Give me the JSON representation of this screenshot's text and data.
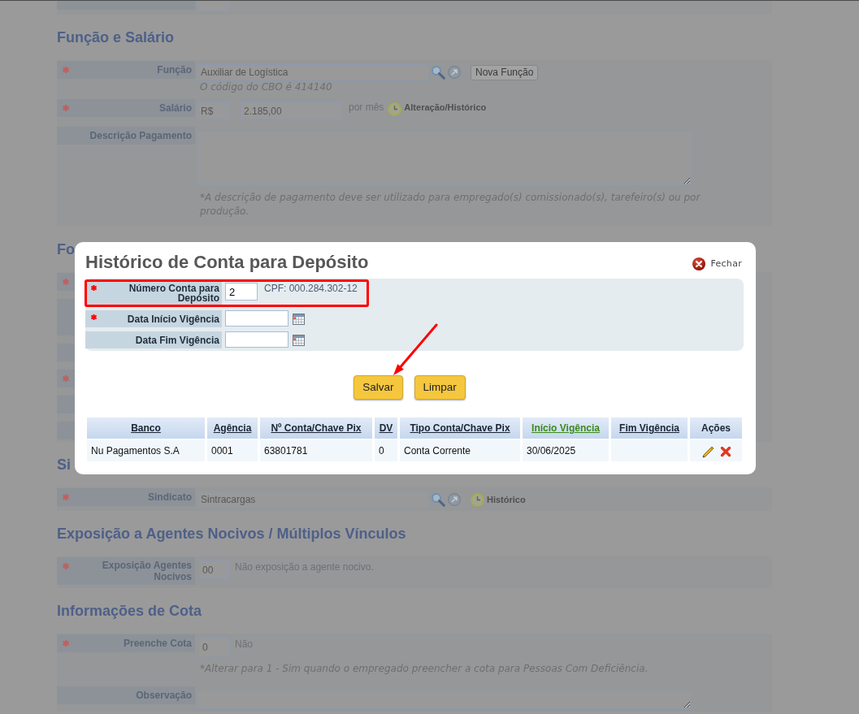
{
  "background_form": {
    "sections": [
      {
        "rows": [
          {
            "kind": "cut_off",
            "required": false
          }
        ]
      },
      {
        "heading": "Função e Salário",
        "rows": [
          {
            "kind": "lookup",
            "label": "Função",
            "required": true,
            "value": "Auxiliar de Logística",
            "button": "Nova Função",
            "hint": "O código do CBO é 414140"
          },
          {
            "kind": "money",
            "label": "Salário",
            "required": true,
            "currency": "R$",
            "value": "2.185,00",
            "suffix": "por mês",
            "history": "Alteração/Histórico"
          },
          {
            "kind": "textarea",
            "label": "Descrição Pagamento",
            "required": false,
            "hint": "*A descrição de pagamento deve ser utilizado para empregado(s) comissionado(s), tarefeiro(s) ou por produção."
          }
        ]
      },
      {
        "heading": "Fo",
        "rows": [
          {
            "kind": "covered",
            "required": true
          },
          {
            "kind": "covered_tall",
            "required": false
          },
          {
            "kind": "covered",
            "required": false
          },
          {
            "kind": "covered",
            "required": true
          },
          {
            "kind": "covered",
            "required": false
          },
          {
            "kind": "covered",
            "required": false
          }
        ]
      },
      {
        "heading": "Si",
        "rows": [
          {
            "kind": "lookup",
            "label": "Sindicato",
            "required": true,
            "value": "Sintracargas",
            "history": "Histórico"
          }
        ]
      },
      {
        "heading": "Exposição a Agentes Nocivos / Múltiplos Vínculos",
        "rows": [
          {
            "kind": "code",
            "label": "Exposição Agentes Nocivos",
            "required": true,
            "value": "00",
            "description": "Não exposição a agente nocivo."
          }
        ]
      },
      {
        "heading": "Informações de Cota",
        "rows": [
          {
            "kind": "code",
            "label": "Preenche Cota",
            "required": true,
            "value": "0",
            "description": "Não",
            "hint": "*Alterar para 1 - Sim quando o empregado preencher a cota para Pessoas Com Deficiência."
          },
          {
            "kind": "textarea",
            "label": "Observação",
            "required": false
          }
        ]
      }
    ]
  },
  "modal": {
    "title": "Histórico de Conta para Depósito",
    "close": "Fechar",
    "fields": [
      {
        "kind": "text",
        "label": "Número Conta para Depósito",
        "required": true,
        "value": "2",
        "note": "CPF: 000.284.302-12",
        "highlighted": true
      },
      {
        "kind": "date",
        "label": "Data Início Vigência",
        "required": true,
        "highlighted": false
      },
      {
        "kind": "date",
        "label": "Data Fim Vigência",
        "required": false,
        "highlighted": false
      }
    ],
    "buttons": [
      {
        "label": "Salvar",
        "pointed": true
      },
      {
        "label": "Limpar",
        "pointed": false
      }
    ],
    "table": {
      "columns": [
        {
          "kind": "sort",
          "label": "Banco",
          "sorted": false
        },
        {
          "kind": "sort",
          "label": "Agência",
          "sorted": false
        },
        {
          "kind": "sort",
          "label": "Nº Conta/Chave Pix",
          "sorted": false
        },
        {
          "kind": "sort",
          "label": "DV",
          "sorted": false
        },
        {
          "kind": "sort",
          "label": "Tipo Conta/Chave Pix",
          "sorted": false
        },
        {
          "kind": "sort",
          "label": "Início Vigência",
          "sorted": true
        },
        {
          "kind": "sort",
          "label": "Fim Vigência",
          "sorted": false
        },
        {
          "kind": "actions",
          "label": "Ações",
          "sorted": false
        }
      ],
      "rows": [
        {
          "cells": [
            "Nu Pagamentos S.A",
            "0001",
            "63801781",
            "0",
            "Conta Corrente",
            "30/06/2025"
          ]
        }
      ]
    }
  }
}
